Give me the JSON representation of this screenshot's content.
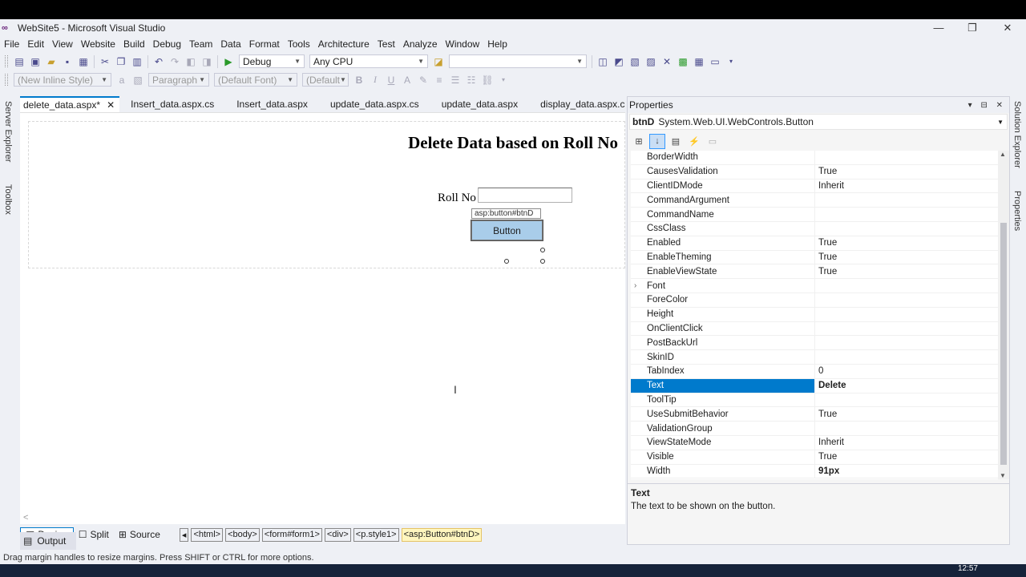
{
  "window": {
    "title": "WebSite5 - Microsoft Visual Studio",
    "logo": "∞",
    "minimize": "—",
    "restore": "❐",
    "close": "✕"
  },
  "menu": [
    "File",
    "Edit",
    "View",
    "Website",
    "Build",
    "Debug",
    "Team",
    "Data",
    "Format",
    "Tools",
    "Architecture",
    "Test",
    "Analyze",
    "Window",
    "Help"
  ],
  "toolbar1": {
    "config": "Debug",
    "platform": "Any CPU",
    "find": ""
  },
  "toolbar2": {
    "style": "(New Inline Style)",
    "block": "Paragraph",
    "font": "(Default Font)",
    "size": "(Default",
    "bold": "B",
    "italic": "I",
    "underline": "U"
  },
  "side": {
    "server_explorer": "Server Explorer",
    "toolbox": "Toolbox",
    "solution_explorer": "Solution Explorer",
    "properties": "Properties"
  },
  "tabs": [
    {
      "label": "delete_data.aspx*",
      "active": true
    },
    {
      "label": "Insert_data.aspx.cs"
    },
    {
      "label": "Insert_data.aspx"
    },
    {
      "label": "update_data.aspx.cs"
    },
    {
      "label": "update_data.aspx"
    },
    {
      "label": "display_data.aspx.cs"
    },
    {
      "label": "display"
    }
  ],
  "tab_close": "✕",
  "design": {
    "heading": "Delete Data based on Roll No",
    "roll_label": "Roll No",
    "button_tag": "asp:button#btnD",
    "button_text": "Button",
    "cursor": "I",
    "scroll_arrow": "<"
  },
  "viewbar": {
    "design": "Design",
    "split": "Split",
    "source": "Source",
    "crumbs": [
      "<html>",
      "<body>",
      "<form#form1>",
      "<div>",
      "<p.style1>",
      "<asp:Button#btnD>"
    ]
  },
  "properties": {
    "title": "Properties",
    "object_name": "btnD",
    "object_type": "System.Web.UI.WebControls.Button",
    "rows": [
      {
        "name": "BorderWidth",
        "value": ""
      },
      {
        "name": "CausesValidation",
        "value": "True"
      },
      {
        "name": "ClientIDMode",
        "value": "Inherit"
      },
      {
        "name": "CommandArgument",
        "value": ""
      },
      {
        "name": "CommandName",
        "value": ""
      },
      {
        "name": "CssClass",
        "value": ""
      },
      {
        "name": "Enabled",
        "value": "True"
      },
      {
        "name": "EnableTheming",
        "value": "True"
      },
      {
        "name": "EnableViewState",
        "value": "True"
      },
      {
        "name": "Font",
        "value": ""
      },
      {
        "name": "ForeColor",
        "value": ""
      },
      {
        "name": "Height",
        "value": ""
      },
      {
        "name": "OnClientClick",
        "value": ""
      },
      {
        "name": "PostBackUrl",
        "value": ""
      },
      {
        "name": "SkinID",
        "value": ""
      },
      {
        "name": "TabIndex",
        "value": "0"
      },
      {
        "name": "Text",
        "value": "Delete"
      },
      {
        "name": "ToolTip",
        "value": ""
      },
      {
        "name": "UseSubmitBehavior",
        "value": "True"
      },
      {
        "name": "ValidationGroup",
        "value": ""
      },
      {
        "name": "ViewStateMode",
        "value": "Inherit"
      },
      {
        "name": "Visible",
        "value": "True"
      },
      {
        "name": "Width",
        "value": "91px"
      }
    ],
    "desc_title": "Text",
    "desc_text": "The text to be shown on the button."
  },
  "output_tab": "Output",
  "status": "Drag margin handles to resize margins. Press SHIFT or CTRL for more options.",
  "clock": "12:57",
  "accent_color": "#007acc"
}
